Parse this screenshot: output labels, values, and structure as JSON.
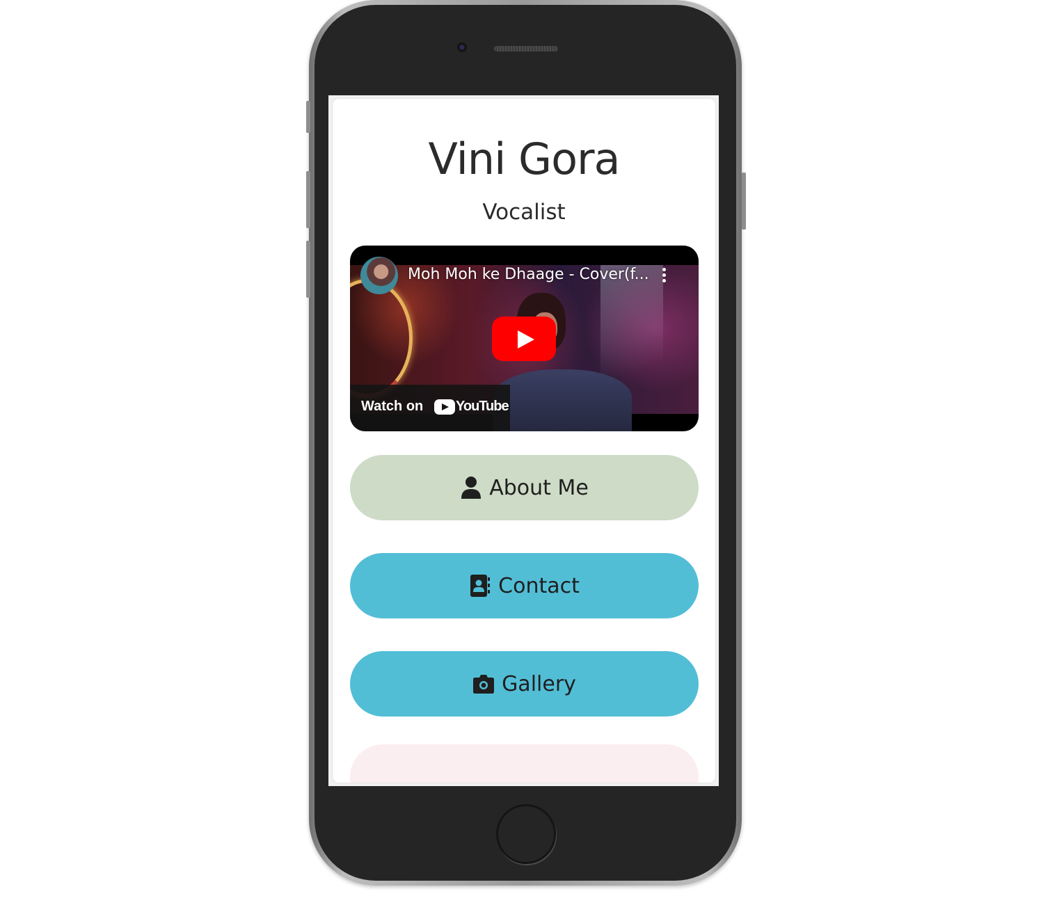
{
  "profile": {
    "name": "Vini Gora",
    "role": "Vocalist"
  },
  "video": {
    "title": "Moh Moh ke Dhaage - Cover(f...",
    "watch_on": "Watch on",
    "platform": "YouTube"
  },
  "links": {
    "about_label": "About Me",
    "contact_label": "Contact",
    "gallery_label": "Gallery"
  },
  "colors": {
    "about_bg": "#cddbc7",
    "contact_bg": "#52bed6",
    "gallery_bg": "#52bed6",
    "next_bg": "#fbeef1",
    "play_button": "#ff0000"
  },
  "icons": {
    "about": "user-icon",
    "contact": "address-book-icon",
    "gallery": "camera-icon",
    "video_menu": "kebab-menu-icon",
    "play": "play-icon"
  }
}
